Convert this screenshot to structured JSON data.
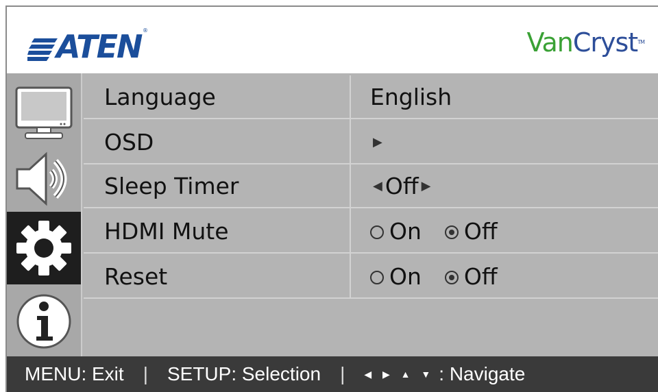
{
  "header": {
    "brand_left": "ATEN",
    "brand_right_van": "Van",
    "brand_right_cryst": "Cryst",
    "brand_right_tm": "TM",
    "brand_left_reg": "®"
  },
  "sidebar": {
    "items": [
      {
        "name": "monitor-icon",
        "active": false
      },
      {
        "name": "speaker-icon",
        "active": false
      },
      {
        "name": "gear-icon",
        "active": true
      },
      {
        "name": "info-icon",
        "active": false
      }
    ]
  },
  "menu": {
    "rows": [
      {
        "label": "Language",
        "value": "English"
      },
      {
        "label": "OSD",
        "value": "▶"
      },
      {
        "label": "Sleep Timer",
        "value": "Off",
        "left_arrow": "◀",
        "right_arrow": "▶"
      },
      {
        "label": "HDMI Mute",
        "option_on": "On",
        "option_off": "Off",
        "selected": "Off"
      },
      {
        "label": "Reset",
        "option_on": "On",
        "option_off": "Off",
        "selected": "Off"
      }
    ]
  },
  "footer": {
    "menu_hint": "MENU: Exit",
    "sep1": "|",
    "setup_hint": "SETUP: Selection",
    "sep2": "|",
    "nav_arrows": "◀ ▶ ▲ ▼",
    "nav_hint": ": Navigate"
  },
  "colors": {
    "brand_blue": "#1b4e9b",
    "brand_green": "#3aa135",
    "menu_bg": "#b4b4b4",
    "footer_bg": "#3a3a3a",
    "active_sidebar": "#1e1e1e"
  }
}
